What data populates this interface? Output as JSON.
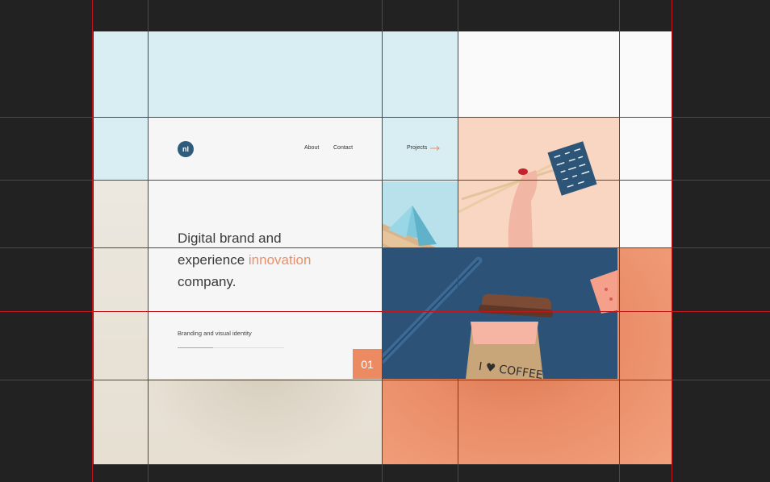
{
  "brand": {
    "logo_text": "nl"
  },
  "nav": {
    "about_label": "About",
    "contact_label": "Contact",
    "projects_label": "Projects"
  },
  "hero": {
    "headline_line1": "Digital brand and",
    "headline_line2_prefix": "experience ",
    "headline_line2_accent": "innovation",
    "headline_line3": "company.",
    "subtitle": "Branding and visual identity",
    "page_number": "01",
    "progress_fraction": 0.33
  },
  "colors": {
    "accent": "#e8906b",
    "brand_blue": "#2f5b7c",
    "light_blue": "#d9eef3",
    "orange": "#ec8a62",
    "guide_line": "#c4141c"
  },
  "icons": [
    "arrow-right-icon",
    "pyramid-photo",
    "chopsticks-photo",
    "coffee-cup-photo"
  ]
}
